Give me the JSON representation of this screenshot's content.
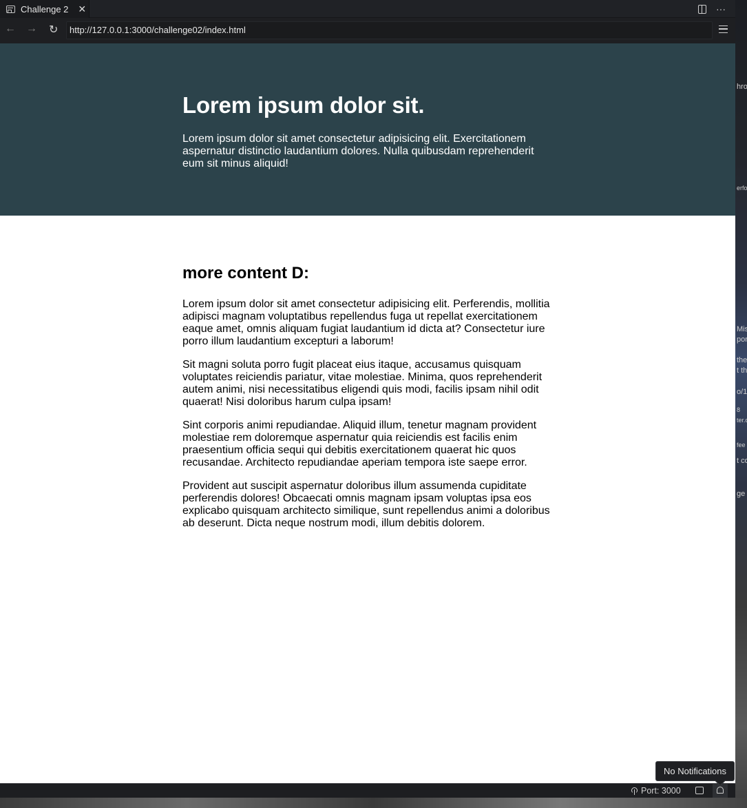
{
  "tab": {
    "title": "Challenge 2",
    "close": "✕"
  },
  "tab_actions": {
    "more": "···"
  },
  "nav": {
    "back": "←",
    "forward": "→",
    "reload": "↻",
    "url": "http://127.0.0.1:3000/challenge02/index.html"
  },
  "hero": {
    "title": "Lorem ipsum dolor sit.",
    "text": "Lorem ipsum dolor sit amet consectetur adipisicing elit. Exercitationem aspernatur distinctio laudantium dolores. Nulla quibusdam reprehenderit eum sit minus aliquid!"
  },
  "content": {
    "heading": "more content D:",
    "paragraphs": [
      "Lorem ipsum dolor sit amet consectetur adipisicing elit. Perferendis, mollitia adipisci magnam voluptatibus repellendus fuga ut repellat exercitationem eaque amet, omnis aliquam fugiat laudantium id dicta at? Consectetur iure porro illum laudantium excepturi a laborum!",
      "Sit magni soluta porro fugit placeat eius itaque, accusamus quisquam voluptates reiciendis pariatur, vitae molestiae. Minima, quos reprehenderit autem animi, nisi necessitatibus eligendi quis modi, facilis ipsam nihil odit quaerat! Nisi doloribus harum culpa ipsam!",
      "Sint corporis animi repudiandae. Aliquid illum, tenetur magnam provident molestiae rem doloremque aspernatur quia reiciendis est facilis enim praesentium officia sequi qui debitis exercitationem quaerat hic quos recusandae. Architecto repudiandae aperiam tempora iste saepe error.",
      "Provident aut suscipit aspernatur doloribus illum assumenda cupiditate perferendis dolores! Obcaecati omnis magnam ipsam voluptas ipsa eos explicabo quisquam architecto similique, sunt repellendus animi a doloribus ab deserunt. Dicta neque nostrum modi, illum debitis dolorem."
    ]
  },
  "status": {
    "port": "Port: 3000",
    "tooltip": "No Notifications"
  },
  "desktop_fragments": [
    "hro",
    "erfo",
    "Miss",
    "pon",
    "the",
    "t th",
    "o/1",
    "8",
    "ter.c",
    "fee",
    "t co",
    "ge"
  ],
  "colors": {
    "hero_bg": "#2c434b",
    "chrome_bg": "#1e1f22"
  }
}
